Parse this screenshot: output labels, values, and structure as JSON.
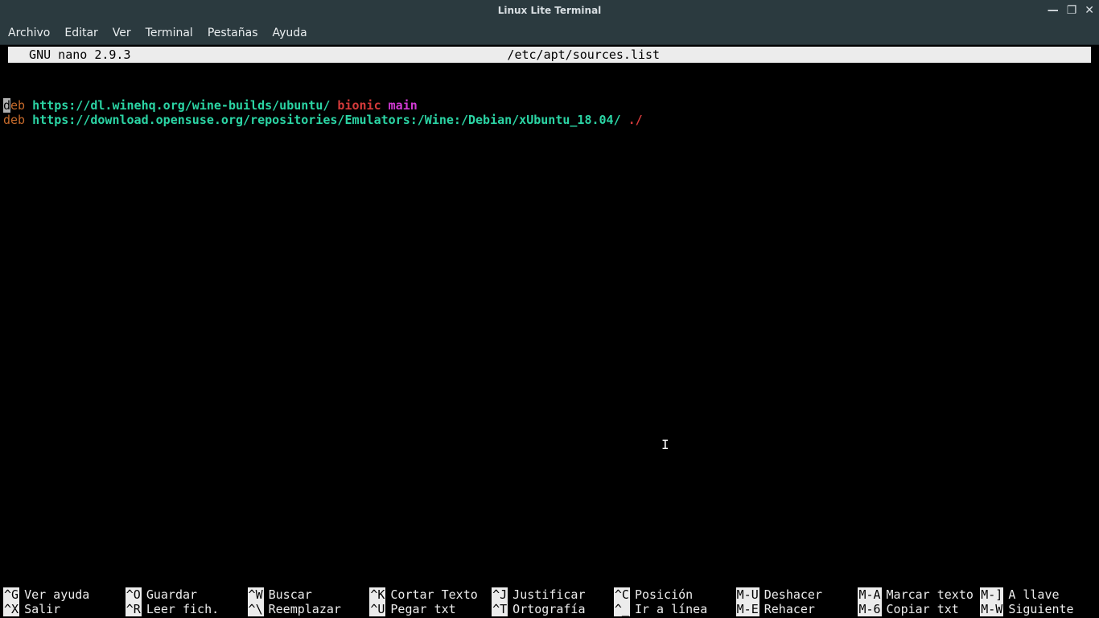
{
  "window": {
    "title": "Linux Lite Terminal",
    "controls": {
      "minimize": "—",
      "maximize": "❐",
      "close": "✕"
    }
  },
  "menubar": {
    "items": [
      {
        "label": "Archivo"
      },
      {
        "label": "Editar"
      },
      {
        "label": "Ver"
      },
      {
        "label": "Terminal"
      },
      {
        "label": "Pestañas"
      },
      {
        "label": "Ayuda"
      }
    ]
  },
  "nano": {
    "version_label": "  GNU nano 2.9.3",
    "file_path": "/etc/apt/sources.list",
    "lines": [
      {
        "cursor_at_start": true,
        "tokens": [
          {
            "text": "d",
            "class": "c-keyword cursor"
          },
          {
            "text": "eb",
            "class": "c-keyword"
          },
          {
            "text": " ",
            "class": ""
          },
          {
            "text": "https://dl.winehq.org/wine-builds/ubuntu/",
            "class": "c-url"
          },
          {
            "text": " ",
            "class": ""
          },
          {
            "text": "bionic",
            "class": "c-dist"
          },
          {
            "text": " ",
            "class": ""
          },
          {
            "text": "main",
            "class": "c-comp"
          }
        ]
      },
      {
        "cursor_at_start": false,
        "tokens": [
          {
            "text": "deb",
            "class": "c-keyword"
          },
          {
            "text": " ",
            "class": ""
          },
          {
            "text": "https://download.opensuse.org/repositories/Emulators:/Wine:/Debian/xUbuntu_18.04/",
            "class": "c-url"
          },
          {
            "text": " ",
            "class": ""
          },
          {
            "text": "./",
            "class": "c-path"
          }
        ]
      }
    ]
  },
  "shortcuts": {
    "row1": [
      {
        "key": "^G",
        "label": "Ver ayuda"
      },
      {
        "key": "^O",
        "label": "Guardar"
      },
      {
        "key": "^W",
        "label": "Buscar"
      },
      {
        "key": "^K",
        "label": "Cortar Texto"
      },
      {
        "key": "^J",
        "label": "Justificar"
      },
      {
        "key": "^C",
        "label": "Posición"
      },
      {
        "key": "M-U",
        "label": "Deshacer"
      },
      {
        "key": "M-A",
        "label": "Marcar texto"
      },
      {
        "key": "M-]",
        "label": "A llave"
      }
    ],
    "row2": [
      {
        "key": "^X",
        "label": "Salir"
      },
      {
        "key": "^R",
        "label": "Leer fich."
      },
      {
        "key": "^\\",
        "label": "Reemplazar"
      },
      {
        "key": "^U",
        "label": "Pegar txt"
      },
      {
        "key": "^T",
        "label": "Ortografía"
      },
      {
        "key": "^_",
        "label": "Ir a línea"
      },
      {
        "key": "M-E",
        "label": "Rehacer"
      },
      {
        "key": "M-6",
        "label": "Copiar txt"
      },
      {
        "key": "M-W",
        "label": "Siguiente"
      }
    ]
  }
}
